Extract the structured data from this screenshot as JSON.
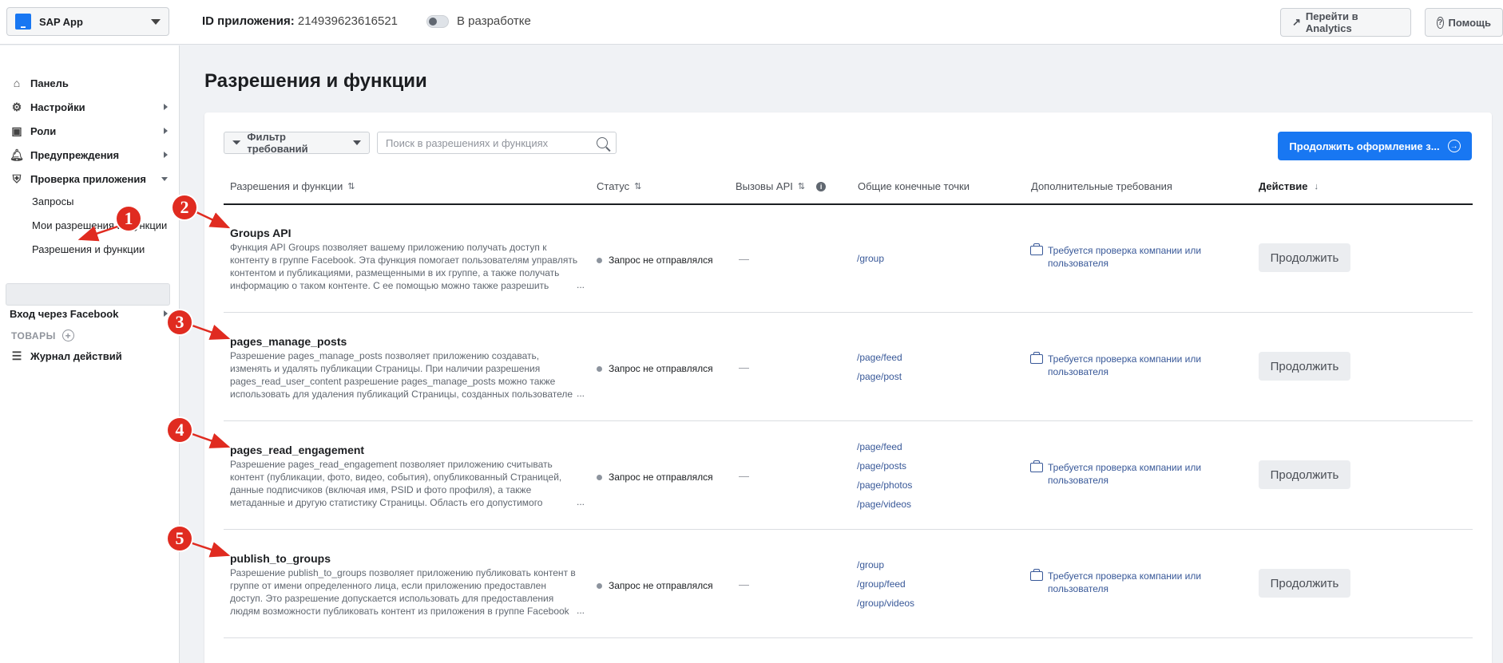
{
  "topbar": {
    "app_name": "SAP App",
    "app_id_label": "ID приложения:",
    "app_id_value": "214939623616521",
    "dev_mode_label": "В разработке",
    "analytics_button": "Перейти в Analytics",
    "help_button": "Помощь"
  },
  "sidebar": {
    "items": [
      {
        "label": "Панель",
        "icon": "home-icon"
      },
      {
        "label": "Настройки",
        "icon": "gear-icon"
      },
      {
        "label": "Роли",
        "icon": "roles-icon"
      },
      {
        "label": "Предупреждения",
        "icon": "bell-icon"
      },
      {
        "label": "Проверка приложения",
        "icon": "shield-icon"
      }
    ],
    "sub_items": [
      "Запросы",
      "Мои разрешения и функции",
      "Разрешения и функции"
    ],
    "section_label": "ТОВАРЫ",
    "product_item": "Вход через Facebook",
    "log_item": "Журнал действий"
  },
  "main": {
    "title": "Разрешения и функции",
    "filter_label": "Фильтр требований",
    "search_placeholder": "Поиск в разрешениях и функциях",
    "primary_button": "Продолжить оформление з...",
    "columns": [
      "Разрешения и функции",
      "Статус",
      "Вызовы API",
      "Общие конечные точки",
      "Дополнительные требования",
      "Действие"
    ],
    "rows": [
      {
        "name": "Groups API",
        "description": "Функция API Groups позволяет вашему приложению получать доступ к контенту в группе Facebook. Эта функция помогает пользователям управлять контентом и публикациями, размещенными в их группе, а также получать информацию о таком контенте. С ее помощью можно также разрешить",
        "status": "Запрос не отправлялся",
        "api_calls": "—",
        "endpoints": [
          "/group"
        ],
        "requirement": "Требуется проверка компании или пользователя",
        "action": "Продолжить"
      },
      {
        "name": "pages_manage_posts",
        "description": "Разрешение pages_manage_posts позволяет приложению создавать, изменять и удалять публикации Страницы. При наличии разрешения pages_read_user_content разрешение pages_manage_posts можно также использовать для удаления публикаций Страницы, созданных пользователе",
        "status": "Запрос не отправлялся",
        "api_calls": "—",
        "endpoints": [
          "/page/feed",
          "/page/post"
        ],
        "requirement": "Требуется проверка компании или пользователя",
        "action": "Продолжить"
      },
      {
        "name": "pages_read_engagement",
        "description": "Разрешение pages_read_engagement позволяет приложению считывать контент (публикации, фото, видео, события), опубликованный Страницей, данные подписчиков (включая имя, PSID и фото профиля), а также метаданные и другую статистику Страницы. Область его допустимого",
        "status": "Запрос не отправлялся",
        "api_calls": "—",
        "endpoints": [
          "/page/feed",
          "/page/posts",
          "/page/photos",
          "/page/videos"
        ],
        "requirement": "Требуется проверка компании или пользователя",
        "action": "Продолжить"
      },
      {
        "name": "publish_to_groups",
        "description": "Разрешение publish_to_groups позволяет приложению публиковать контент в группе от имени определенного лица, если приложению предоставлен доступ. Это разрешение допускается использовать для предоставления людям возможности публиковать контент из приложения в группе Facebook или для",
        "status": "Запрос не отправлялся",
        "api_calls": "—",
        "endpoints": [
          "/group",
          "/group/feed",
          "/group/videos"
        ],
        "requirement": "Требуется проверка компании или пользователя",
        "action": "Продолжить"
      }
    ],
    "ellipsis": "..."
  },
  "annotations": [
    "1",
    "2",
    "3",
    "4",
    "5"
  ],
  "colors": {
    "accent": "#1877f2",
    "link": "#385898",
    "annotation": "#e02b20"
  }
}
